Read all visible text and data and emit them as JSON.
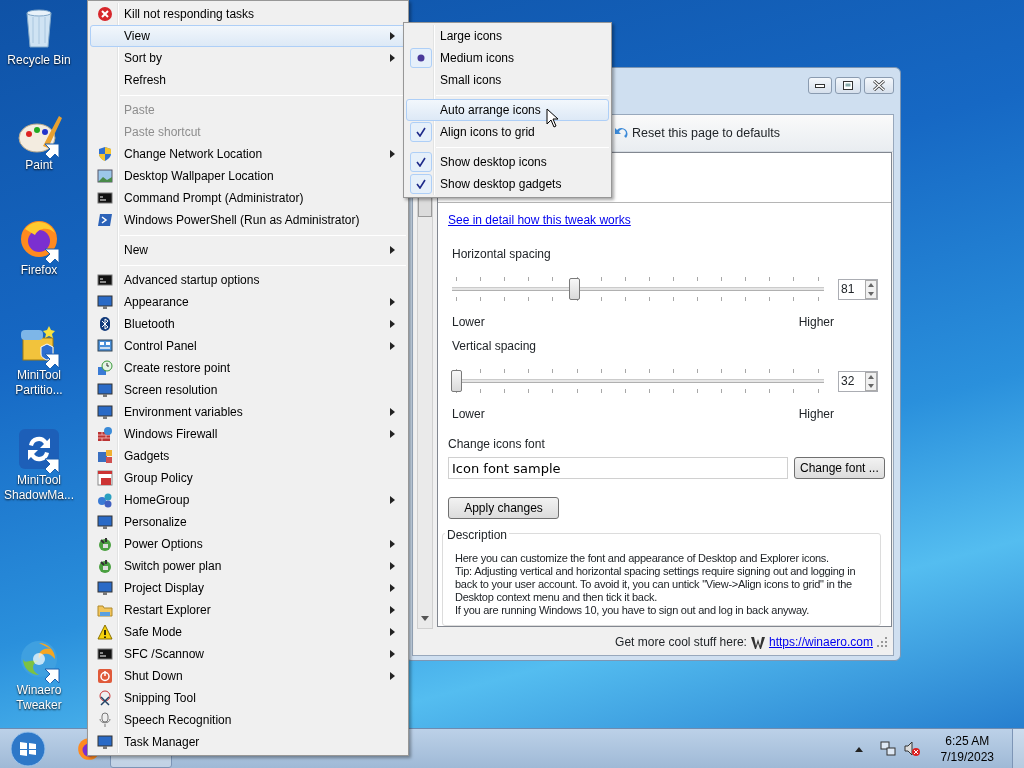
{
  "desktop_icons": [
    {
      "label": "Recycle Bin",
      "shortcut": false
    },
    {
      "label": "Paint",
      "shortcut": true
    },
    {
      "label": "Firefox",
      "shortcut": true
    },
    {
      "label": "MiniTool Partitio...",
      "shortcut": true
    },
    {
      "label": "MiniTool ShadowMa...",
      "shortcut": true
    },
    {
      "label": "Winaero Tweaker",
      "shortcut": true
    }
  ],
  "window": {
    "toolbar": {
      "reset_button": "Reset this page to defaults"
    },
    "link": "See in detail how this tweak works",
    "sliders": [
      {
        "label": "Horizontal spacing",
        "level": 0.33,
        "value": "81",
        "min_label": "Lower",
        "max_label": "Higher"
      },
      {
        "label": "Vertical spacing",
        "level": 0,
        "value": "32",
        "min_label": "Lower",
        "max_label": "Higher"
      }
    ],
    "font": {
      "label": "Change icons font",
      "value": "Icon font sample",
      "button": "Change font ..."
    },
    "apply_button": "Apply changes",
    "description": {
      "title": "Description",
      "paragraphs": [
        "Here you can customize the font and appearance of Desktop and Explorer icons.",
        "Tip: Adjusting vertical and horizontal spacing settings require signing out and logging in back to your user account. To avoid it, you can untick \"View->Align icons to grid\" in the Desktop context menu and then tick it back.",
        "If you are running Windows 10, you have to sign out and log in back anyway."
      ]
    },
    "footer": {
      "text": "Get more cool stuff here:",
      "link": "https://winaero.com"
    }
  },
  "context_menu": {
    "items": [
      {
        "kind": "item",
        "label": "Kill not responding tasks",
        "submenu": false,
        "disabled": false,
        "highlighted": false
      },
      {
        "kind": "item",
        "label": "View",
        "submenu": true,
        "disabled": false,
        "highlighted": true
      },
      {
        "kind": "item",
        "label": "Sort by",
        "submenu": true,
        "disabled": false,
        "highlighted": false
      },
      {
        "kind": "item",
        "label": "Refresh",
        "submenu": false,
        "disabled": false,
        "highlighted": false
      },
      {
        "kind": "separator"
      },
      {
        "kind": "item",
        "label": "Paste",
        "submenu": false,
        "disabled": true,
        "highlighted": false
      },
      {
        "kind": "item",
        "label": "Paste shortcut",
        "submenu": false,
        "disabled": true,
        "highlighted": false
      },
      {
        "kind": "item",
        "label": "Change Network Location",
        "submenu": true,
        "disabled": false,
        "highlighted": false
      },
      {
        "kind": "item",
        "label": "Desktop Wallpaper Location",
        "submenu": false,
        "disabled": false,
        "highlighted": false
      },
      {
        "kind": "item",
        "label": "Command Prompt (Administrator)",
        "submenu": false,
        "disabled": false,
        "highlighted": false
      },
      {
        "kind": "item",
        "label": "Windows PowerShell (Run as Administrator)",
        "submenu": false,
        "disabled": false,
        "highlighted": false
      },
      {
        "kind": "separator"
      },
      {
        "kind": "item",
        "label": "New",
        "submenu": true,
        "disabled": false,
        "highlighted": false
      },
      {
        "kind": "separator"
      },
      {
        "kind": "item",
        "label": "Advanced startup options",
        "submenu": false,
        "disabled": false,
        "highlighted": false
      },
      {
        "kind": "item",
        "label": "Appearance",
        "submenu": true,
        "disabled": false,
        "highlighted": false
      },
      {
        "kind": "item",
        "label": "Bluetooth",
        "submenu": true,
        "disabled": false,
        "highlighted": false
      },
      {
        "kind": "item",
        "label": "Control Panel",
        "submenu": true,
        "disabled": false,
        "highlighted": false
      },
      {
        "kind": "item",
        "label": "Create restore point",
        "submenu": false,
        "disabled": false,
        "highlighted": false
      },
      {
        "kind": "item",
        "label": "Screen resolution",
        "submenu": false,
        "disabled": false,
        "highlighted": false
      },
      {
        "kind": "item",
        "label": "Environment variables",
        "submenu": true,
        "disabled": false,
        "highlighted": false
      },
      {
        "kind": "item",
        "label": "Windows Firewall",
        "submenu": true,
        "disabled": false,
        "highlighted": false
      },
      {
        "kind": "item",
        "label": "Gadgets",
        "submenu": false,
        "disabled": false,
        "highlighted": false
      },
      {
        "kind": "item",
        "label": "Group Policy",
        "submenu": false,
        "disabled": false,
        "highlighted": false
      },
      {
        "kind": "item",
        "label": "HomeGroup",
        "submenu": true,
        "disabled": false,
        "highlighted": false
      },
      {
        "kind": "item",
        "label": "Personalize",
        "submenu": false,
        "disabled": false,
        "highlighted": false
      },
      {
        "kind": "item",
        "label": "Power Options",
        "submenu": true,
        "disabled": false,
        "highlighted": false
      },
      {
        "kind": "item",
        "label": "Switch power plan",
        "submenu": true,
        "disabled": false,
        "highlighted": false
      },
      {
        "kind": "item",
        "label": "Project Display",
        "submenu": true,
        "disabled": false,
        "highlighted": false
      },
      {
        "kind": "item",
        "label": "Restart Explorer",
        "submenu": true,
        "disabled": false,
        "highlighted": false
      },
      {
        "kind": "item",
        "label": "Safe Mode",
        "submenu": true,
        "disabled": false,
        "highlighted": false
      },
      {
        "kind": "item",
        "label": "SFC /Scannow",
        "submenu": true,
        "disabled": false,
        "highlighted": false
      },
      {
        "kind": "item",
        "label": "Shut Down",
        "submenu": true,
        "disabled": false,
        "highlighted": false
      },
      {
        "kind": "item",
        "label": "Snipping Tool",
        "submenu": false,
        "disabled": false,
        "highlighted": false
      },
      {
        "kind": "item",
        "label": "Speech Recognition",
        "submenu": false,
        "disabled": false,
        "highlighted": false
      },
      {
        "kind": "item",
        "label": "Task Manager",
        "submenu": false,
        "disabled": false,
        "highlighted": false
      }
    ]
  },
  "view_submenu": {
    "items": [
      {
        "kind": "radio",
        "label": "Large icons",
        "selected": false,
        "highlighted": false
      },
      {
        "kind": "radio",
        "label": "Medium icons",
        "selected": true,
        "highlighted": false
      },
      {
        "kind": "radio",
        "label": "Small icons",
        "selected": false,
        "highlighted": false
      },
      {
        "kind": "separator"
      },
      {
        "kind": "check",
        "label": "Auto arrange icons",
        "checked": false,
        "highlighted": true
      },
      {
        "kind": "check",
        "label": "Align icons to grid",
        "checked": true,
        "highlighted": false
      },
      {
        "kind": "separator"
      },
      {
        "kind": "check",
        "label": "Show desktop icons",
        "checked": true,
        "highlighted": false
      },
      {
        "kind": "check",
        "label": "Show desktop gadgets",
        "checked": true,
        "highlighted": false
      }
    ]
  },
  "taskbar": {
    "clock": {
      "time": "6:25 AM",
      "date": "7/19/2023"
    }
  }
}
